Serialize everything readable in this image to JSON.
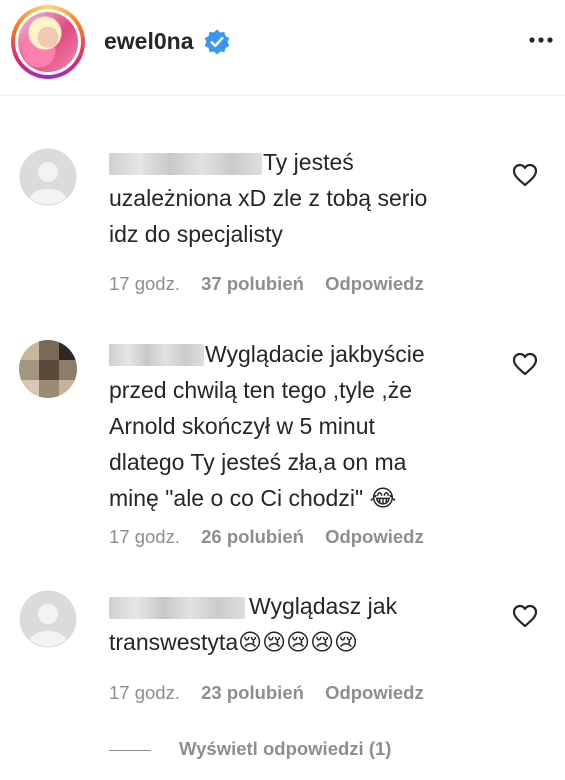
{
  "header": {
    "username": "ewel0na",
    "verified": true,
    "more_icon": "more-dots-icon"
  },
  "comments": [
    {
      "text_lines": [
        "Ty jesteś",
        "uzależniona xD zle z tobą serio",
        "idz do specjalisty"
      ],
      "time": "17 godz.",
      "likes": "37 polubień",
      "reply": "Odpowiedz"
    },
    {
      "text_lines": [
        "Wyglądacie jakbyście",
        "przed chwilą ten tego ,tyle ,że",
        "Arnold skończył w 5 minut",
        "dlatego Ty jesteś zła,a on ma",
        "minę \"ale o co Ci chodzi\""
      ],
      "emoji": "😂",
      "time": "17 godz.",
      "likes": "26 polubień",
      "reply": "Odpowiedz"
    },
    {
      "text_lines": [
        "Wyglądasz jak",
        "transwestyta"
      ],
      "emoji_sequence": [
        "😢",
        "😢",
        "😢",
        "😢",
        "😢"
      ],
      "time": "17 godz.",
      "likes": "23 polubień",
      "reply": "Odpowiedz"
    }
  ],
  "view_replies": "Wyświetl odpowiedzi (1)"
}
